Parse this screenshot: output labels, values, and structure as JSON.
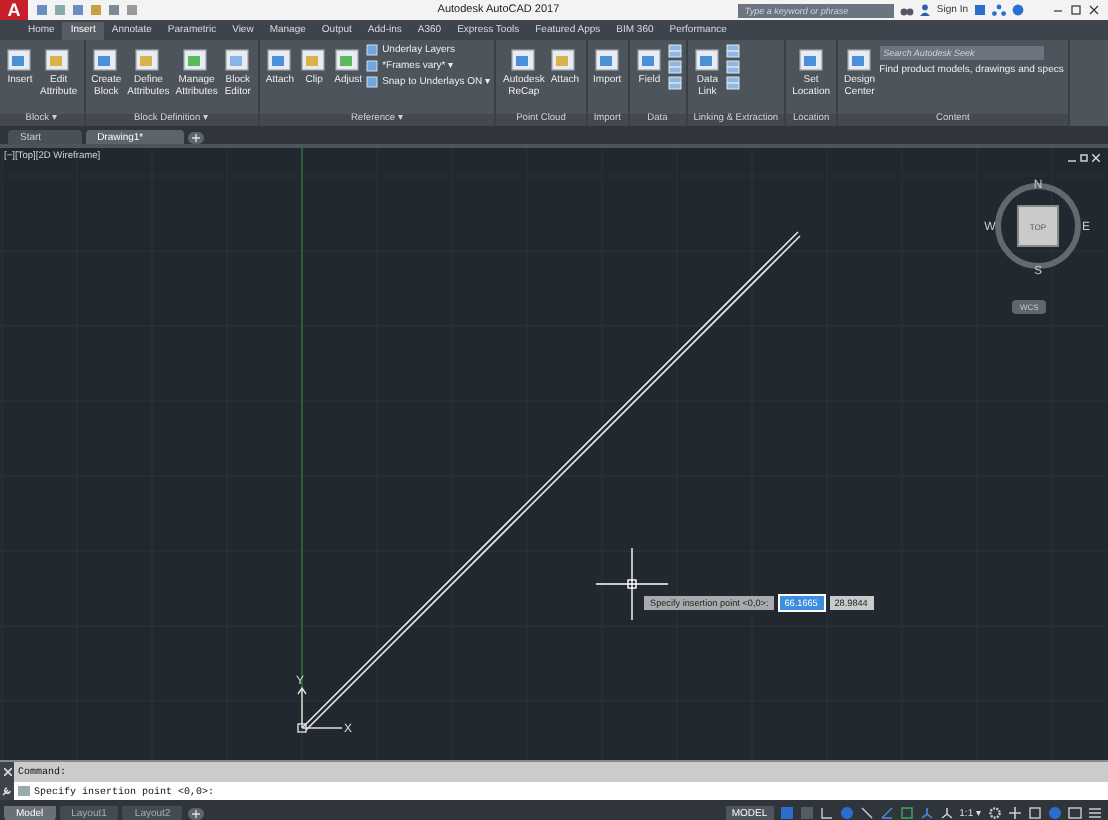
{
  "title_bar": {
    "logo": "A",
    "title": "Autodesk AutoCAD 2017",
    "search": {
      "placeholder": "Type a keyword or phrase"
    },
    "sign_in": "Sign In"
  },
  "ribbon_tabs": [
    {
      "label": "Home",
      "selected": false
    },
    {
      "label": "Insert",
      "selected": true
    },
    {
      "label": "Annotate",
      "selected": false
    },
    {
      "label": "Parametric",
      "selected": false
    },
    {
      "label": "View",
      "selected": false
    },
    {
      "label": "Manage",
      "selected": false
    },
    {
      "label": "Output",
      "selected": false
    },
    {
      "label": "Add-ins",
      "selected": false
    },
    {
      "label": "A360",
      "selected": false
    },
    {
      "label": "Express Tools",
      "selected": false
    },
    {
      "label": "Featured Apps",
      "selected": false
    },
    {
      "label": "BIM 360",
      "selected": false
    },
    {
      "label": "Performance",
      "selected": false
    }
  ],
  "ribbon_panels": [
    {
      "title": "Block ▾",
      "tools": [
        {
          "kind": "large",
          "label": "Insert"
        },
        {
          "kind": "large",
          "label": "Edit Attribute"
        }
      ]
    },
    {
      "title": "Block Definition ▾",
      "tools": [
        {
          "kind": "large",
          "label": "Create Block"
        },
        {
          "kind": "large",
          "label": "Define Attributes"
        },
        {
          "kind": "large",
          "label": "Manage Attributes"
        },
        {
          "kind": "large",
          "label": "Block Editor"
        }
      ]
    },
    {
      "title": "Reference ▾",
      "tools": [
        {
          "kind": "large",
          "label": "Attach"
        },
        {
          "kind": "large",
          "label": "Clip"
        },
        {
          "kind": "large",
          "label": "Adjust"
        },
        {
          "kind": "small",
          "label": "Underlay Layers"
        },
        {
          "kind": "small",
          "label": "*Frames vary* ▾"
        },
        {
          "kind": "small",
          "label": "Snap to Underlays ON ▾"
        }
      ]
    },
    {
      "title": "Point Cloud",
      "tools": [
        {
          "kind": "large",
          "label": "Autodesk ReCap"
        },
        {
          "kind": "large",
          "label": "Attach"
        }
      ]
    },
    {
      "title": "Import",
      "tools": [
        {
          "kind": "large",
          "label": "Import"
        }
      ]
    },
    {
      "title": "Data",
      "tools": [
        {
          "kind": "large",
          "label": "Field"
        },
        {
          "kind": "icon"
        },
        {
          "kind": "icon"
        },
        {
          "kind": "icon"
        }
      ]
    },
    {
      "title": "Linking & Extraction",
      "tools": [
        {
          "kind": "large",
          "label": "Data Link"
        },
        {
          "kind": "icon"
        },
        {
          "kind": "icon"
        },
        {
          "kind": "icon"
        }
      ]
    },
    {
      "title": "Location",
      "tools": [
        {
          "kind": "large",
          "label": "Set Location"
        }
      ]
    },
    {
      "title": "Content",
      "tools": [
        {
          "kind": "large",
          "label": "Design Center"
        },
        {
          "kind": "seek",
          "placeholder": "Search Autodesk Seek",
          "caption": "Find product models, drawings and specs"
        }
      ]
    }
  ],
  "document_tabs": [
    {
      "label": "Start",
      "selected": false
    },
    {
      "label": "Drawing1*",
      "selected": true
    }
  ],
  "viewport": {
    "label": "[−][Top][2D Wireframe]",
    "viewcube": {
      "face": "TOP",
      "north": "N",
      "south": "S",
      "east": "E",
      "west": "W",
      "ucs_menu": "WCS"
    },
    "ucs": {
      "x": "X",
      "y": "Y"
    },
    "tooltip": {
      "prompt": "Specify insertion point <0,0>:",
      "x_value": "66.1665",
      "y_value": "28.9844"
    }
  },
  "command_line": {
    "history": "Command:",
    "prompt": "Specify insertion point <0,0>:"
  },
  "layout_tabs": [
    {
      "label": "Model",
      "selected": true
    },
    {
      "label": "Layout1",
      "selected": false
    },
    {
      "label": "Layout2",
      "selected": false
    }
  ],
  "status_bar": {
    "space": "MODEL",
    "scale": "1:1 ▾"
  }
}
